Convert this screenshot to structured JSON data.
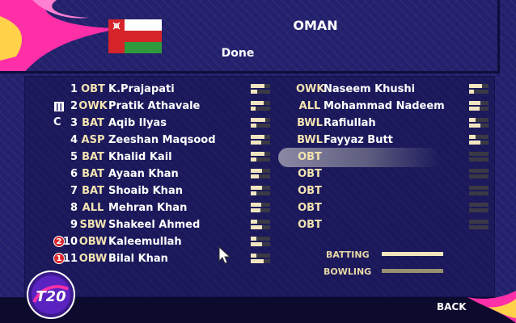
{
  "header": {
    "country": "OMAN",
    "done_label": "Done",
    "flag_colors": {
      "white": "#ffffff",
      "red": "#d6242b",
      "green": "#2f9a3b"
    }
  },
  "left_list": [
    {
      "num": "1",
      "role": "OBT",
      "name": "K.Prajapati",
      "marker": "",
      "bat": 0.7,
      "bowl": 0.35
    },
    {
      "num": "2",
      "role": "OWK",
      "name": "Pratik Athavale",
      "marker": "wicketkeeper",
      "bat": 0.65,
      "bowl": 0.25
    },
    {
      "num": "3",
      "role": "BAT",
      "name": "Aqib Ilyas",
      "marker": "C",
      "bat": 0.75,
      "bowl": 0.3
    },
    {
      "num": "4",
      "role": "ASP",
      "name": "Zeeshan Maqsood",
      "marker": "",
      "bat": 0.7,
      "bowl": 0.55
    },
    {
      "num": "5",
      "role": "BAT",
      "name": "Khalid Kail",
      "marker": "",
      "bat": 0.7,
      "bowl": 0.3
    },
    {
      "num": "6",
      "role": "BAT",
      "name": "Ayaan Khan",
      "marker": "",
      "bat": 0.6,
      "bowl": 0.4
    },
    {
      "num": "7",
      "role": "BAT",
      "name": "Shoaib Khan",
      "marker": "",
      "bat": 0.6,
      "bowl": 0.3
    },
    {
      "num": "8",
      "role": "ALL",
      "name": "Mehran Khan",
      "marker": "",
      "bat": 0.55,
      "bowl": 0.5
    },
    {
      "num": "9",
      "role": "SBW",
      "name": "Shakeel Ahmed",
      "marker": "",
      "bat": 0.35,
      "bowl": 0.6
    },
    {
      "num": "10",
      "role": "OBW",
      "name": "Kaleemullah",
      "marker": "2",
      "bat": 0.3,
      "bowl": 0.6
    },
    {
      "num": "11",
      "role": "OBW",
      "name": "Bilal Khan",
      "marker": "1",
      "bat": 0.3,
      "bowl": 0.65
    }
  ],
  "right_list": [
    {
      "role": "OWK",
      "name": "Naseem Khushi",
      "bat": 0.65,
      "bowl": 0.25
    },
    {
      "role": "ALL",
      "name": "Mohammad Nadeem",
      "bat": 0.6,
      "bowl": 0.55
    },
    {
      "role": "BWL",
      "name": "Rafiullah",
      "bat": 0.35,
      "bowl": 0.6
    },
    {
      "role": "BWL",
      "name": "Fayyaz Butt",
      "bat": 0.35,
      "bowl": 0.6
    },
    {
      "role": "OBT",
      "name": "",
      "bat": 0,
      "bowl": 0
    },
    {
      "role": "OBT",
      "name": "",
      "bat": 0,
      "bowl": 0
    },
    {
      "role": "OBT",
      "name": "",
      "bat": 0,
      "bowl": 0
    },
    {
      "role": "OBT",
      "name": "",
      "bat": 0,
      "bowl": 0
    },
    {
      "role": "OBT",
      "name": "",
      "bat": 0,
      "bowl": 0
    }
  ],
  "legend": {
    "batting_label": "BATTING",
    "bowling_label": "BOWLING"
  },
  "footer": {
    "back_label": "BACK",
    "logo_icon": "t20-world-cup-logo-icon"
  },
  "colors": {
    "background": "#24216e",
    "role_text": "#f3e3b0",
    "accent_pink": "#ff2fa8",
    "badge_red": "#d8262c"
  }
}
